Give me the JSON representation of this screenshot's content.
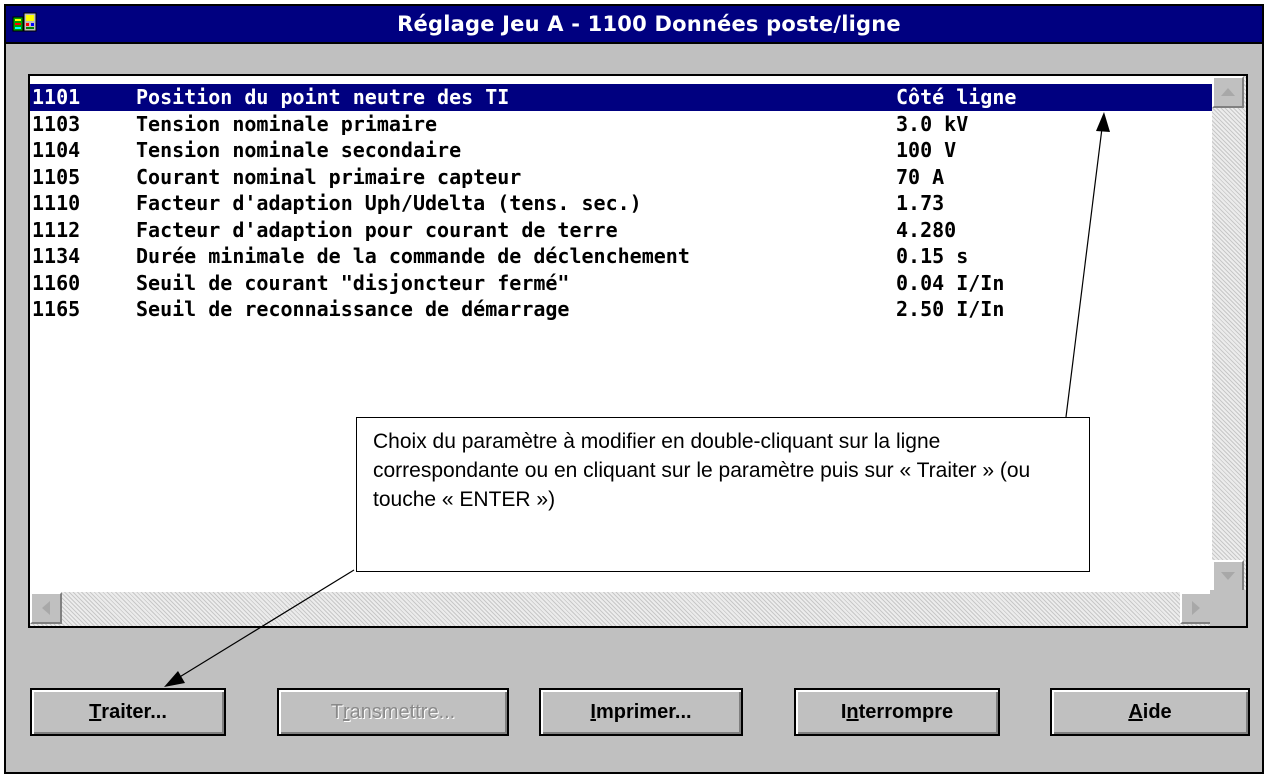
{
  "window": {
    "title": "Réglage Jeu A - 1100  Données poste/ligne"
  },
  "list": {
    "rows": [
      {
        "code": "1101",
        "label": "Position du point neutre des TI",
        "value": "Côté ligne"
      },
      {
        "code": "1103",
        "label": "Tension nominale primaire",
        "value": "3.0 kV"
      },
      {
        "code": "1104",
        "label": "Tension nominale secondaire",
        "value": "100 V"
      },
      {
        "code": "1105",
        "label": "Courant nominal primaire capteur",
        "value": "70 A"
      },
      {
        "code": "1110",
        "label": "Facteur d'adaption Uph/Udelta (tens. sec.)",
        "value": "1.73"
      },
      {
        "code": "1112",
        "label": "Facteur d'adaption pour courant de terre",
        "value": "4.280"
      },
      {
        "code": "1134",
        "label": "Durée minimale de la commande de déclenchement",
        "value": "0.15 s"
      },
      {
        "code": "1160",
        "label": "Seuil de courant \"disjoncteur fermé\"",
        "value": "0.04 I/In"
      },
      {
        "code": "1165",
        "label": "Seuil de reconnaissance de démarrage",
        "value": "2.50 I/In"
      }
    ],
    "selected_index": 0
  },
  "buttons": {
    "traiter": {
      "mnemonic": "T",
      "rest": "raiter..."
    },
    "transmettre": {
      "pre": "T",
      "mnemonic": "r",
      "rest": "ansmettre..."
    },
    "imprimer": {
      "mnemonic": "I",
      "rest": "mprimer..."
    },
    "interrompre": {
      "pre": "I",
      "mnemonic": "n",
      "rest": "terrompre"
    },
    "aide": {
      "mnemonic": "A",
      "rest": "ide"
    }
  },
  "callout": {
    "text": "Choix du paramètre à modifier en double-cliquant sur la ligne correspondante ou en cliquant sur le paramètre puis sur « Traiter » (ou touche « ENTER »)"
  },
  "colors": {
    "titlebar": "#000080",
    "selection": "#000080",
    "face": "#c0c0c0"
  },
  "icons": {
    "system_menu": "app-icon",
    "scroll_up": "arrow-up-icon",
    "scroll_down": "arrow-down-icon",
    "scroll_left": "arrow-left-icon",
    "scroll_right": "arrow-right-icon"
  }
}
